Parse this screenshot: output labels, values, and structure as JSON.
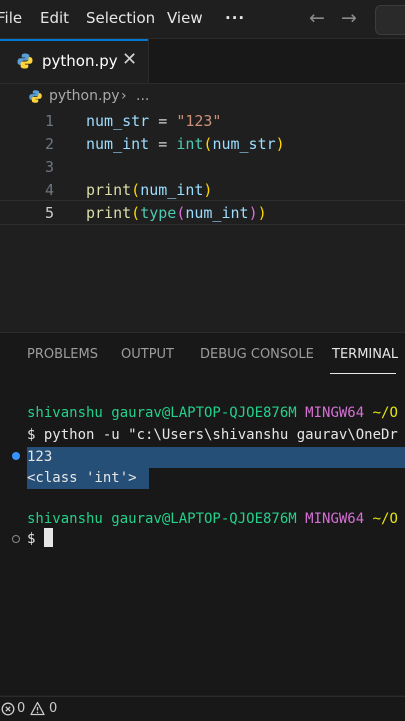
{
  "menubar": {
    "items": [
      "File",
      "Edit",
      "Selection",
      "View"
    ],
    "more_label": "···",
    "back_icon": "arrow-left-icon",
    "forward_icon": "arrow-right-icon"
  },
  "tabs": [
    {
      "label": "python.py",
      "icon": "python-icon",
      "close": "✕",
      "active": true
    }
  ],
  "breadcrumb": {
    "file": "python.py",
    "separator": "›",
    "more": "..."
  },
  "editor": {
    "line_numbers": [
      "1",
      "2",
      "3",
      "4",
      "5"
    ],
    "current_line": "5",
    "tokens": {
      "l1_var": "num_str",
      "l1_eq": " = ",
      "l1_str": "\"123\"",
      "l2_var": "num_int",
      "l2_eq": " = ",
      "l2_fn": "int",
      "l2_open": "(",
      "l2_arg": "num_str",
      "l2_close": ")",
      "l4_fn": "print",
      "l4_open": "(",
      "l4_arg": "num_int",
      "l4_close": ")",
      "l5_fn": "print",
      "l5_open": "(",
      "l5_cls": "type",
      "l5_open2": "(",
      "l5_arg": "num_int",
      "l5_close2": ")",
      "l5_close": ")"
    }
  },
  "panel": {
    "tabs": [
      "PROBLEMS",
      "OUTPUT",
      "DEBUG CONSOLE",
      "TERMINAL"
    ],
    "active_tab": "TERMINAL"
  },
  "terminal": {
    "prompt1_user": "shivanshu gaurav@LAPTOP-QJOE876M",
    "prompt1_env": "MINGW64",
    "prompt1_path": "~/O",
    "command": "$ python -u \"c:\\Users\\shivanshu gaurav\\OneDr",
    "output_1": "123",
    "output_2": "<class 'int'>",
    "prompt2_user": "shivanshu gaurav@LAPTOP-QJOE876M",
    "prompt2_env": "MINGW64",
    "prompt2_path": "~/O",
    "prompt_symbol": "$"
  },
  "statusbar": {
    "errors_icon": "error-icon",
    "errors_count": "0",
    "warnings_icon": "warning-icon",
    "warnings_count": "0"
  },
  "colors": {
    "accent": "#0078d4",
    "terminal_green": "#23d18b",
    "terminal_magenta": "#d670d6",
    "terminal_yellow": "#e5e510",
    "selection": "#264f78"
  }
}
